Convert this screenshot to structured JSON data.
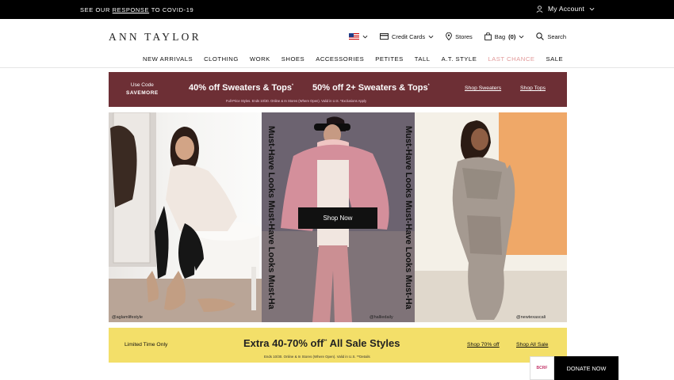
{
  "topbar": {
    "covid_prefix": "SEE OUR ",
    "covid_link": "RESPONSE",
    "covid_suffix": " TO COVID-19",
    "account_label": "My Account"
  },
  "header": {
    "logo": "ANN TAYLOR",
    "credit_cards": "Credit Cards",
    "stores": "Stores",
    "bag": "Bag",
    "bag_count": "(0)",
    "search": "Search"
  },
  "nav": {
    "items": [
      "NEW ARRIVALS",
      "CLOTHING",
      "WORK",
      "SHOES",
      "ACCESSORIES",
      "PETITES",
      "TALL",
      "A.T. STYLE",
      "LAST CHANCE",
      "SALE"
    ]
  },
  "promo": {
    "use_code": "Use Code",
    "code": "SAVEMORE",
    "offer1": "40% off Sweaters & Tops",
    "offer2": "50% off 2+ Sweaters & Tops",
    "star": "*",
    "shop_sweaters": "Shop Sweaters",
    "shop_tops": "Shop Tops",
    "fine_print": "Full-Price Styles. Ends 10/30. Online & In Stores (Where Open). Valid in U.S. *Exclusions Apply"
  },
  "hero": {
    "handle1": "@aglamlifestyle",
    "handle2": "@halliedaily",
    "handle3": "@newtexascali",
    "vertical_text": "Must-Have Looks Must-Have Looks Must-Ha",
    "shop_now": "Shop Now"
  },
  "sale": {
    "limited": "Limited Time Only",
    "headline": "Extra 40-70% off",
    "stars": "**",
    "headline_tail": " All Sale Styles",
    "shop_70": "Shop 70% off",
    "shop_all": "Shop All Sale",
    "fine_print": "Ends 10/30. Online & In Stores (Where Open). Valid in U.S. **Details"
  },
  "donate": {
    "org": "BCRF",
    "label": "DONATE NOW"
  },
  "colors": {
    "promo_bg": "#6d2f35",
    "sale_bg": "#f3df69",
    "last_chance": "#e29a9a"
  }
}
